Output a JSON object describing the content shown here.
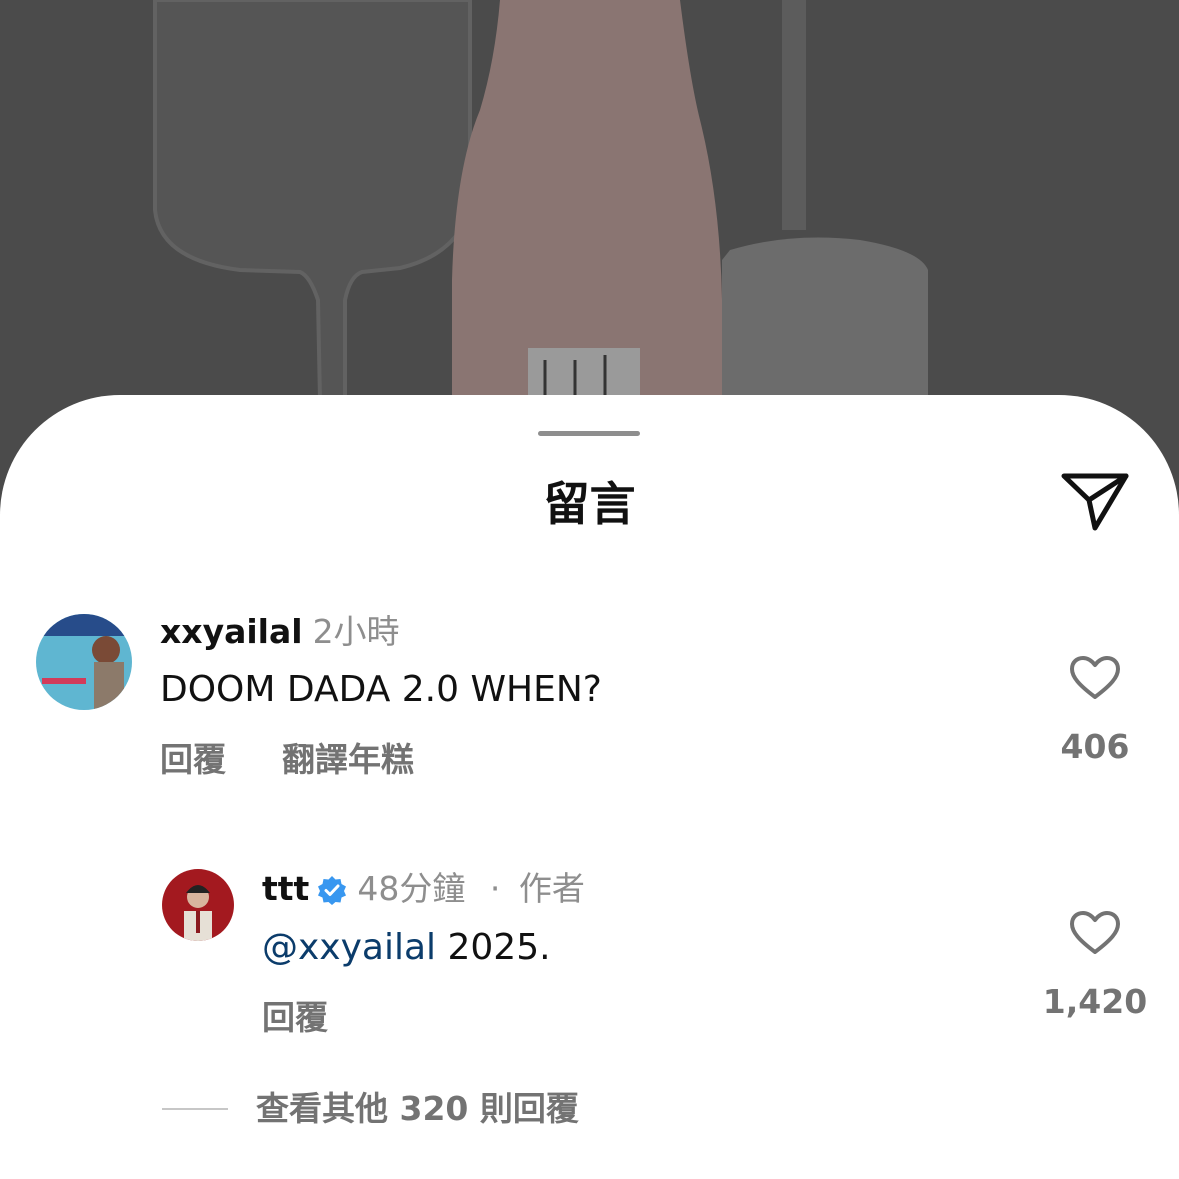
{
  "sheet": {
    "title": "留言"
  },
  "comments": [
    {
      "username": "xxyailal",
      "time": "2小時",
      "text": "DOOM DADA 2.0 WHEN?",
      "reply_label": "回覆",
      "translate_label": "翻譯年糕",
      "likes": "406"
    }
  ],
  "reply": {
    "username": "ttt",
    "verified": true,
    "time": "48分鐘",
    "separator": "·",
    "author_label": "作者",
    "mention": "@xxyailal",
    "text": " 2025.",
    "reply_label": "回覆",
    "likes": "1,420"
  },
  "view_more": "查看其他 320 則回覆",
  "colors": {
    "accent_verified": "#3897f0",
    "mention": "#0b3c6b",
    "muted": "#8e8e8e"
  }
}
